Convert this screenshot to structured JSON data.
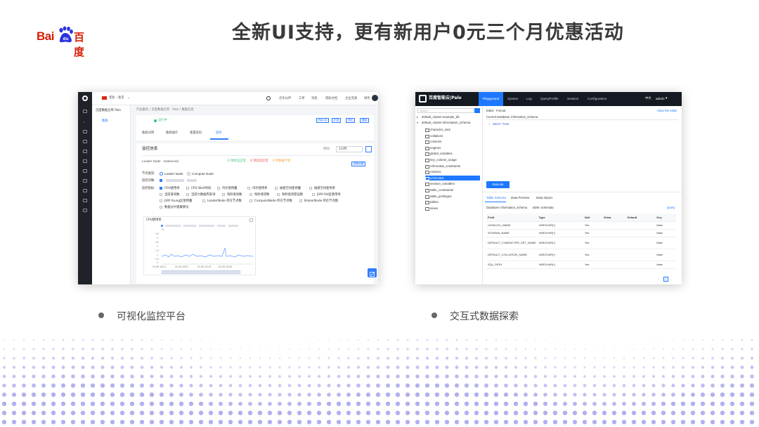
{
  "slide": {
    "logo": {
      "latin": "Bai",
      "paw": "du",
      "chinese": "百度"
    },
    "headline": "全新UI支持，更有新用户0元三个月优惠活动",
    "captions": [
      "可视化监控平台",
      "交互式数据探索"
    ]
  },
  "left_shot": {
    "region": "华北 - 北京",
    "product": "百度数据仓库 Palo",
    "top_links": [
      "合作伙伴",
      "工单",
      "消息",
      "帮助文档",
      "企业资源",
      "财务"
    ],
    "side_item": "集群",
    "breadcrumb": "产品服务 / 百度数据仓库 - Palo / 集群信息",
    "status": "运行中",
    "header_buttons": [
      "Palo UI",
      "扩容",
      "停止",
      "删除"
    ],
    "tabs": [
      "集群详情",
      "集群操作",
      "重置密码",
      "监控"
    ],
    "active_tab": "监控",
    "section_title": "监控信息",
    "time_label": "时间:",
    "time_value": "1小时",
    "leader_node": "Leader Node · Instanceid:",
    "node_status": [
      "0 项状态正常",
      "0 项状态异常",
      "0 项数据不足"
    ],
    "alarm_button": "报警设置",
    "node_type_label": "节点类型:",
    "node_types": [
      "Leader Node",
      "Compute Node"
    ],
    "monitor_label": "监控对象:",
    "metric_label": "监控指标:",
    "metrics": [
      [
        "CPU使用率",
        "CPU Wait时间",
        "内存使用量",
        "内存使用率",
        "磁盘空间使用量",
        "磁盘空间使用率"
      ],
      [
        "当前查询数",
        "当前大数据库查询",
        "每秒查询数",
        "每秒请求数",
        "每秒查询错误数",
        "JVM Old区使用率"
      ],
      [
        "JVM Young区使用量",
        "LeaderNode 所在节点数",
        "ComputeNode 所在节点数",
        "BrokerNode 所在节点数"
      ],
      [
        "数据分片健康情况"
      ]
    ],
    "chart": {
      "title": "CPU使用率",
      "unit": "%",
      "y_ticks": [
        "3.5",
        "3",
        "2.5",
        "2",
        "1.5",
        "1",
        "0.5",
        "0"
      ],
      "x_ticks": [
        "01-09 18:41",
        "01-09 19:07",
        "01-09 19:13",
        "01-09 19:29"
      ]
    }
  },
  "right_shot": {
    "brand": "百度智能云|Palo",
    "nav": [
      "Playground",
      "System",
      "Log",
      "QueryProfile",
      "Session",
      "Configuration"
    ],
    "lang": "中文",
    "user": "admin",
    "search_placeholder": "Search",
    "databases": [
      "default_cluster:example_db",
      "default_cluster:information_schema"
    ],
    "tables": [
      "character_sets",
      "collations",
      "columns",
      "engines",
      "global_variables",
      "key_column_usage",
      "referential_constraints",
      "routines",
      "schemata",
      "session_variables",
      "table_constraints",
      "table_privileges",
      "tables",
      "views"
    ],
    "selected_table": "schemata",
    "editor_tabs": [
      "Editor",
      "Format"
    ],
    "clear_label": "Clear the editor",
    "current_db": "Current Database: information_schema",
    "editor_line": "1",
    "editor_code": "select * from",
    "execute": "Execute",
    "result_tabs": [
      "Table Schema",
      "Data Preview",
      "Data Import"
    ],
    "db_label": "Database: information_schema",
    "table_label": "table: schemata",
    "query_link": "Query",
    "columns": [
      "Field",
      "Type",
      "Null",
      "Extra",
      "Default",
      "Key"
    ],
    "rows": [
      [
        "CATALOG_NAME",
        "VARCHAR(*)",
        "Yes",
        "",
        "",
        "false"
      ],
      [
        "SCHEMA_NAME",
        "VARCHAR(*)",
        "Yes",
        "",
        "",
        "false"
      ],
      [
        "DEFAULT_CHARACTER_SET_NAME",
        "VARCHAR(*)",
        "Yes",
        "",
        "",
        "false"
      ],
      [
        "DEFAULT_COLLATION_NAME",
        "VARCHAR(*)",
        "Yes",
        "",
        "",
        "false"
      ],
      [
        "SQL_PATH",
        "VARCHAR(*)",
        "Yes",
        "",
        "",
        "false"
      ]
    ],
    "page": "1"
  },
  "colors": {
    "accent": "#1e78ff",
    "brand_red": "#d81e06",
    "dot_purple": "#a9a7ec"
  }
}
